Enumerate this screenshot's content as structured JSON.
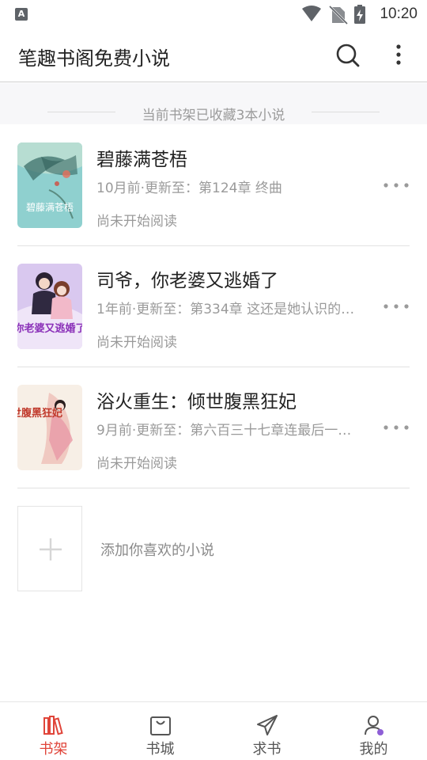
{
  "status_bar": {
    "time": "10:20",
    "notification_icon_text": "A"
  },
  "app_bar": {
    "title": "笔趣书阁免费小说"
  },
  "shelf": {
    "summary": "当前书架已收藏3本小说"
  },
  "books": [
    {
      "title": "碧藤满苍梧",
      "update": "10月前·更新至：第124章 终曲",
      "progress": "尚未开始阅读",
      "cover_text": "碧藤满苍梧"
    },
    {
      "title": "司爷，你老婆又逃婚了",
      "update": "1年前·更新至：第334章 这还是她认识的…",
      "progress": "尚未开始阅读",
      "cover_text": "你老婆又逃婚了"
    },
    {
      "title": "浴火重生：倾世腹黑狂妃",
      "update": "9月前·更新至：第六百三十七章连最后一…",
      "progress": "尚未开始阅读",
      "cover_text": "倾世腹黑狂妃"
    }
  ],
  "add_book": {
    "label": "添加你喜欢的小说"
  },
  "bottom_nav": [
    {
      "label": "书架",
      "active": true
    },
    {
      "label": "书城",
      "active": false
    },
    {
      "label": "求书",
      "active": false
    },
    {
      "label": "我的",
      "active": false
    }
  ],
  "colors": {
    "accent": "#e0453a",
    "muted_text": "#9a9a9a",
    "divider": "#e2e2e2"
  }
}
